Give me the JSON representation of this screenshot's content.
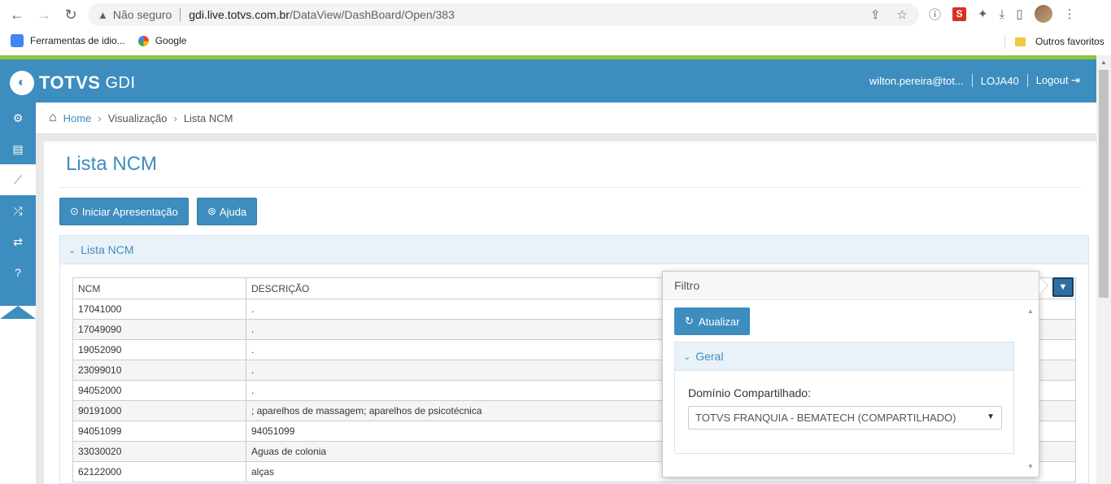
{
  "browser": {
    "security_label": "Não seguro",
    "url_host": "gdi.live.totvs.com.br",
    "url_path": "/DataView/DashBoard/Open/383",
    "bookmarks": [
      {
        "label": "Ferramentas de idio..."
      },
      {
        "label": "Google"
      }
    ],
    "other_bookmarks": "Outros favoritos",
    "ext_s": "S"
  },
  "app": {
    "logo_brand": "TOTVS",
    "logo_product": "GDI",
    "user": "wilton.pereira@tot...",
    "store": "LOJA40",
    "logout": "Logout"
  },
  "breadcrumb": {
    "home": "Home",
    "level1": "Visualização",
    "current": "Lista NCM"
  },
  "page": {
    "title": "Lista NCM",
    "btn_presentation": "Iniciar Apresentação",
    "btn_help": "Ajuda",
    "section_title": "Lista NCM"
  },
  "table": {
    "headers": [
      "NCM",
      "DESCRIÇÃO"
    ],
    "rows": [
      [
        "17041000",
        "."
      ],
      [
        "17049090",
        "."
      ],
      [
        "19052090",
        "."
      ],
      [
        "23099010",
        "."
      ],
      [
        "94052000",
        "."
      ],
      [
        "90191000",
        "; aparelhos de massagem; aparelhos de psicotécnica"
      ],
      [
        "94051099",
        "94051099"
      ],
      [
        "33030020",
        "Aguas de colonia"
      ],
      [
        "62122000",
        "alças"
      ]
    ]
  },
  "filter": {
    "title": "Filtro",
    "refresh": "Atualizar",
    "group": "Geral",
    "field_label": "Domínio Compartilhado:",
    "field_value": "TOTVS FRANQUIA - BEMATECH (COMPARTILHADO)"
  },
  "colors": {
    "brand_blue": "#3d8dbf",
    "accent_green": "#8cc63f"
  }
}
